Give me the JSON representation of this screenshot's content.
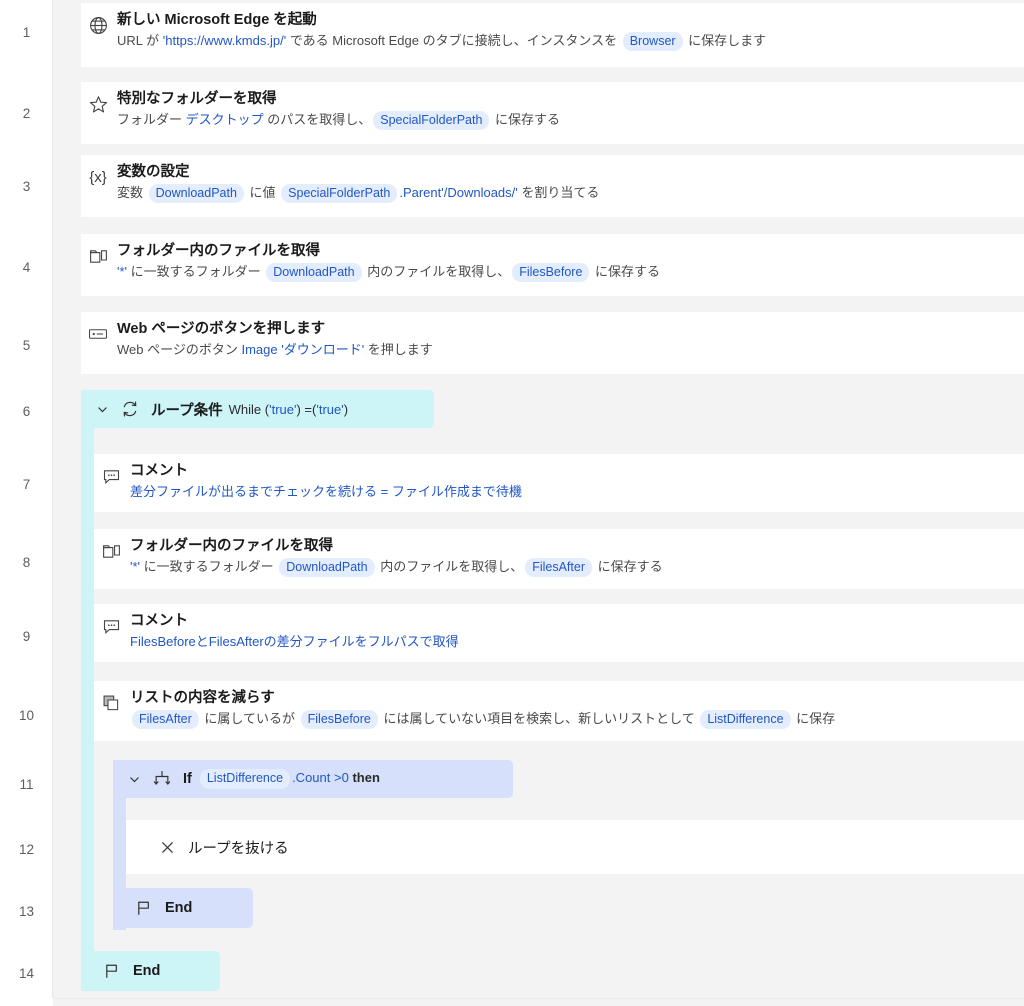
{
  "app": {
    "name": "Power Automate Desktop - flow designer",
    "colors": {
      "loop_block": "#cdf4f7",
      "if_block": "#d6e0fa",
      "variable_chip_bg": "#e3edfd",
      "variable_chip_text": "#2157c4",
      "card_bg": "#ffffff",
      "canvas_bg": "#f3f3f3"
    }
  },
  "gutter": {
    "numbers": [
      "1",
      "2",
      "3",
      "4",
      "5",
      "6",
      "7",
      "8",
      "9",
      "10",
      "11",
      "12",
      "13",
      "14"
    ]
  },
  "steps": [
    {
      "number": "1",
      "icon": "globe-icon",
      "title": "新しい Microsoft Edge を起動",
      "desc_parts": [
        {
          "t": "text",
          "v": "URL が "
        },
        {
          "t": "link",
          "v": "'https://www.kmds.jp/'"
        },
        {
          "t": "text",
          "v": " である Microsoft Edge のタブに接続し、インスタンスを "
        },
        {
          "t": "chip",
          "v": "Browser"
        },
        {
          "t": "text",
          "v": " に保存します"
        }
      ]
    },
    {
      "number": "2",
      "icon": "star-icon",
      "title": "特別なフォルダーを取得",
      "desc_parts": [
        {
          "t": "text",
          "v": "フォルダー "
        },
        {
          "t": "link",
          "v": "デスクトップ"
        },
        {
          "t": "text",
          "v": " のパスを取得し、"
        },
        {
          "t": "chip",
          "v": "SpecialFolderPath"
        },
        {
          "t": "text",
          "v": " に保存する"
        }
      ]
    },
    {
      "number": "3",
      "icon": "variable-x-icon",
      "title": "変数の設定",
      "desc_parts": [
        {
          "t": "text",
          "v": "変数 "
        },
        {
          "t": "chip",
          "v": "DownloadPath"
        },
        {
          "t": "text",
          "v": " に値 "
        },
        {
          "t": "chip",
          "v": "SpecialFolderPath"
        },
        {
          "t": "link",
          "v": ".Parent'/Downloads/'"
        },
        {
          "t": "text",
          "v": " を割り当てる"
        }
      ]
    },
    {
      "number": "4",
      "icon": "folder-files-icon",
      "title": "フォルダー内のファイルを取得",
      "desc_parts": [
        {
          "t": "link",
          "v": "'*'"
        },
        {
          "t": "text",
          "v": " に一致するフォルダー "
        },
        {
          "t": "chip",
          "v": "DownloadPath"
        },
        {
          "t": "text",
          "v": " 内のファイルを取得し、"
        },
        {
          "t": "chip",
          "v": "FilesBefore"
        },
        {
          "t": "text",
          "v": " に保存する"
        }
      ]
    },
    {
      "number": "5",
      "icon": "web-button-icon",
      "title": "Web ページのボタンを押します",
      "desc_parts": [
        {
          "t": "text",
          "v": "Web ページのボタン "
        },
        {
          "t": "link",
          "v": "Image 'ダウンロード'"
        },
        {
          "t": "text",
          "v": " を押します"
        }
      ]
    },
    {
      "number": "6",
      "icon": "loop-icon",
      "title": "ループ条件",
      "sub": "While ('true') =('true')",
      "sub_highlight": "'true'"
    },
    {
      "number": "7",
      "icon": "comment-icon",
      "title": "コメント",
      "desc_parts": [
        {
          "t": "link",
          "v": "差分ファイルが出るまでチェックを続ける = ファイル作成まで待機"
        }
      ]
    },
    {
      "number": "8",
      "icon": "folder-files-icon",
      "title": "フォルダー内のファイルを取得",
      "desc_parts": [
        {
          "t": "link",
          "v": "'*'"
        },
        {
          "t": "text",
          "v": " に一致するフォルダー "
        },
        {
          "t": "chip",
          "v": "DownloadPath"
        },
        {
          "t": "text",
          "v": " 内のファイルを取得し、"
        },
        {
          "t": "chip",
          "v": "FilesAfter"
        },
        {
          "t": "text",
          "v": " に保存する"
        }
      ]
    },
    {
      "number": "9",
      "icon": "comment-icon",
      "title": "コメント",
      "desc_parts": [
        {
          "t": "link",
          "v": "FilesBeforeとFilesAfterの差分ファイルをフルパスで取得"
        }
      ]
    },
    {
      "number": "10",
      "icon": "list-subtract-icon",
      "title": "リストの内容を減らす",
      "desc_parts": [
        {
          "t": "chip",
          "v": "FilesAfter"
        },
        {
          "t": "text",
          "v": " に属しているが "
        },
        {
          "t": "chip",
          "v": "FilesBefore"
        },
        {
          "t": "text",
          "v": " には属していない項目を検索し、新しいリストとして "
        },
        {
          "t": "chip",
          "v": "ListDifference"
        },
        {
          "t": "text",
          "v": " に保存"
        }
      ]
    },
    {
      "number": "11",
      "icon": "if-branch-icon",
      "title": "If",
      "cond_parts": [
        {
          "t": "chip",
          "v": "ListDifference"
        },
        {
          "t": "link",
          "v": ".Count >0"
        },
        {
          "t": "bold",
          "v": "then"
        }
      ]
    },
    {
      "number": "12",
      "icon": "close-x-icon",
      "title": "ループを抜ける"
    },
    {
      "number": "13",
      "icon": "flag-icon",
      "title": "End"
    },
    {
      "number": "14",
      "icon": "flag-icon",
      "title": "End"
    }
  ]
}
